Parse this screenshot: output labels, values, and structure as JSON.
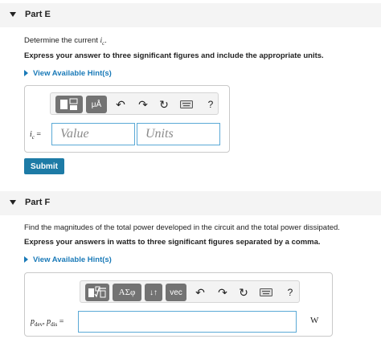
{
  "part_e": {
    "title": "Part E",
    "prompt": "Determine the current ",
    "prompt_var": "i",
    "prompt_sub": "c",
    "instruction": "Express your answer to three significant figures and include the appropriate units.",
    "hint_label": "View Available Hint(s)",
    "toolbar": {
      "micro_label": "μÅ",
      "help_label": "?"
    },
    "answer_label_var": "i",
    "answer_label_sub": "c",
    "answer_label_eq": " =",
    "value_placeholder": "Value",
    "units_placeholder": "Units",
    "submit_label": "Submit"
  },
  "part_f": {
    "title": "Part F",
    "prompt": "Find the magnitudes of the total power developed in the circuit and the total power dissipated.",
    "instruction": "Express your answers in watts to three significant figures separated by a comma.",
    "hint_label": "View Available Hint(s)",
    "toolbar": {
      "greek_label": "ΑΣφ",
      "sort_label": "↓↑",
      "vec_label": "vec",
      "help_label": "?"
    },
    "answer_label": "p",
    "answer_label_sub1": "dev",
    "answer_label_mid": ", p",
    "answer_label_sub2": "dis",
    "answer_label_eq": " =",
    "unit": "W"
  }
}
